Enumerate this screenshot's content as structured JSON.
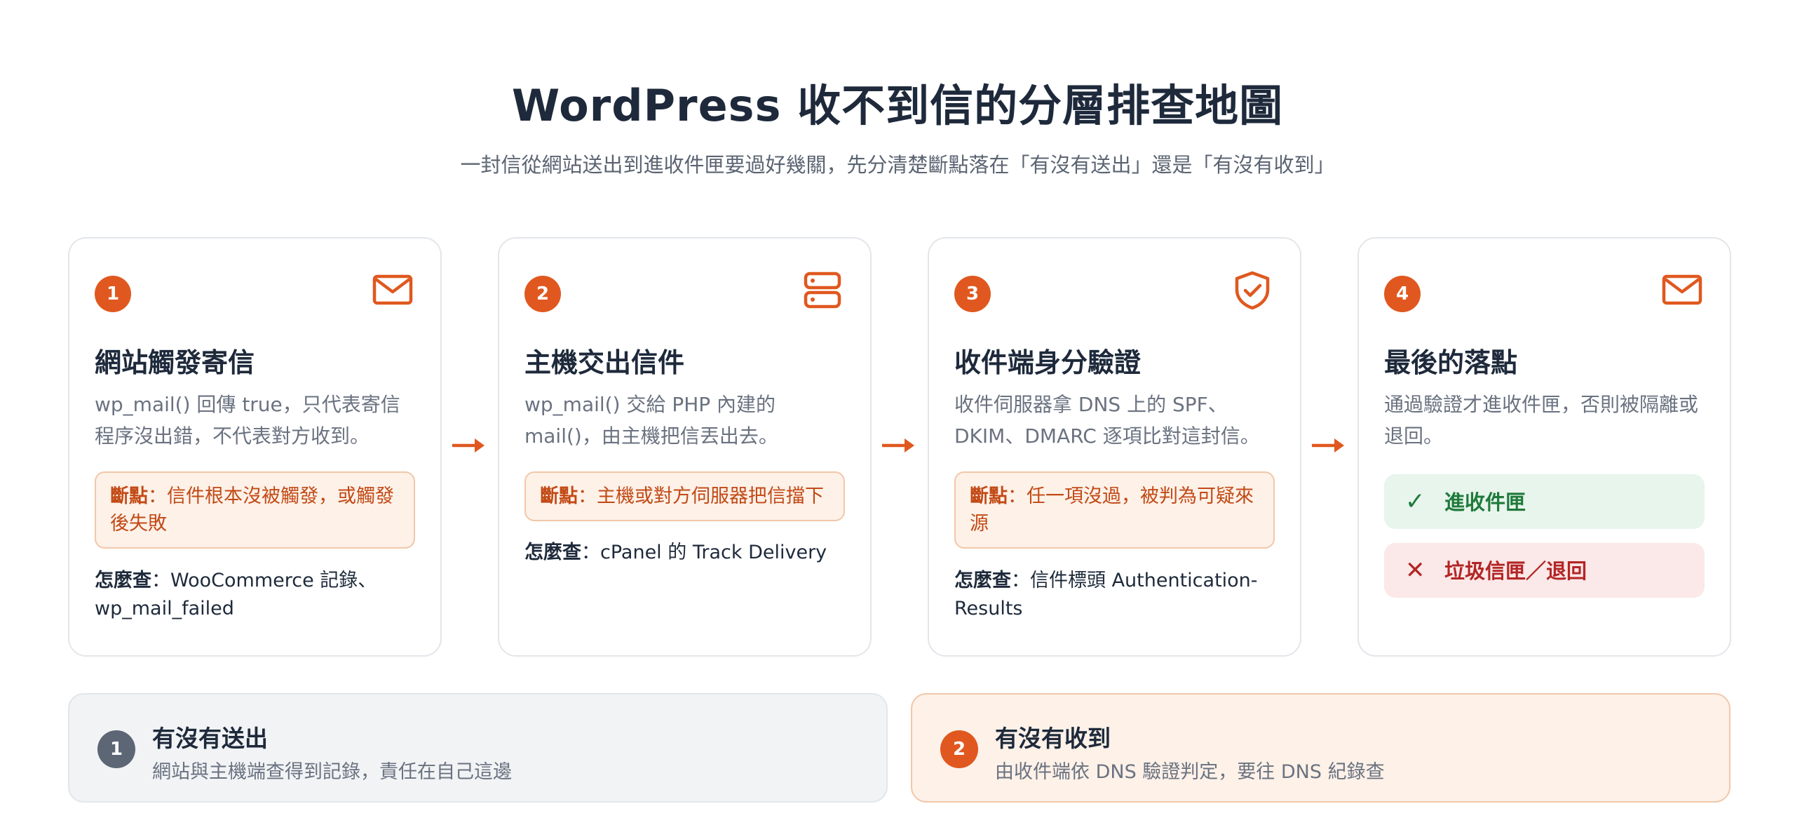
{
  "header": {
    "title": "WordPress 收不到信的分層排查地圖",
    "subtitle": "一封信從網站送出到進收件匣要過好幾關，先分清楚斷點落在「有沒有送出」還是「有沒有收到」"
  },
  "colors": {
    "accent": "#e0581f",
    "break_bg": "#fdf1e8",
    "ok": "#1f7a3b",
    "error": "#b32525"
  },
  "steps": [
    {
      "number": "1",
      "icon": "mail-icon",
      "title": "網站觸發寄信",
      "desc": "wp_mail() 回傳 true，只代表寄信程序沒出錯，不代表對方收到。",
      "break_label": "斷點",
      "break_text": "：信件根本沒被觸發，或觸發後失敗",
      "howto_label": "怎麼查",
      "howto_text": "：WooCommerce 記錄、wp_mail_failed"
    },
    {
      "number": "2",
      "icon": "server-icon",
      "title": "主機交出信件",
      "desc": "wp_mail() 交給 PHP 內建的 mail()，由主機把信丟出去。",
      "break_label": "斷點",
      "break_text": "：主機或對方伺服器把信擋下",
      "howto_label": "怎麼查",
      "howto_text": "：cPanel 的 Track Delivery"
    },
    {
      "number": "3",
      "icon": "shield-check-icon",
      "title": "收件端身分驗證",
      "desc": "收件伺服器拿 DNS 上的 SPF、DKIM、DMARC 逐項比對這封信。",
      "break_label": "斷點",
      "break_text": "：任一項沒過，被判為可疑來源",
      "howto_label": "怎麼查",
      "howto_text": "：信件標頭 Authentication-Results"
    },
    {
      "number": "4",
      "icon": "mail-icon",
      "title": "最後的落點",
      "desc": "通過驗證才進收件匣，否則被隔離或退回。",
      "result_ok": "進收件匣",
      "result_no": "垃圾信匣／退回"
    }
  ],
  "summary": [
    {
      "number": "1",
      "title": "有沒有送出",
      "desc": "網站與主機端查得到記錄，責任在自己這邊"
    },
    {
      "number": "2",
      "title": "有沒有收到",
      "desc": "由收件端依 DNS 驗證判定，要往 DNS 紀錄查"
    }
  ]
}
